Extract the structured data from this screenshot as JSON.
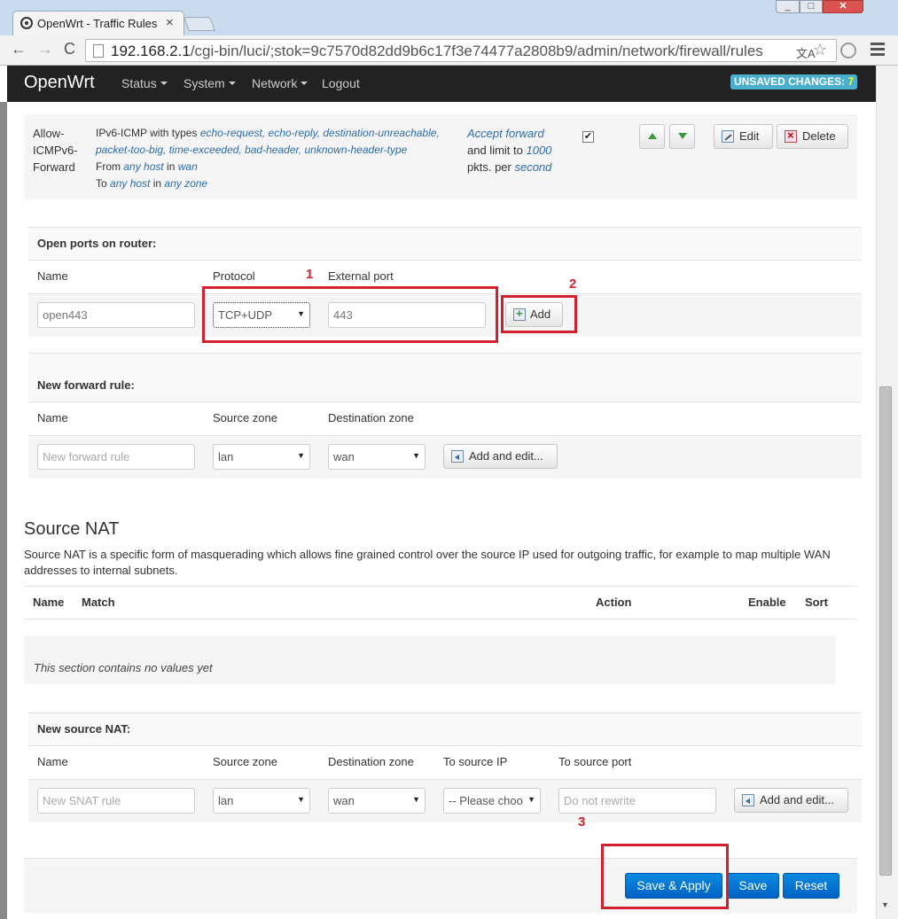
{
  "browser": {
    "tab_title": "OpenWrt - Traffic Rules",
    "tab_close": "×",
    "win_min": "_",
    "win_max": "□",
    "win_close": "✕",
    "back": "←",
    "forward": "→",
    "reload": "C",
    "url_host": "192.168.2.1",
    "url_path": "/cgi-bin/luci/;stok=9c7570d82dd9b6c17f3e74477a2808b9/admin/network/firewall/rules",
    "translate": "文A",
    "star": "☆"
  },
  "header": {
    "brand": "OpenWrt",
    "nav": [
      "Status",
      "System",
      "Network",
      "Logout"
    ],
    "unsaved_label": "UNSAVED CHANGES:",
    "unsaved_count": "7"
  },
  "rule": {
    "name": "Allow-ICMPv6-Forward",
    "match_prefix": "IPv6-ICMP with types ",
    "types": "echo-request, echo-reply, destination-unreachable, packet-too-big, time-exceeded, bad-header, unknown-header-type",
    "from_prefix": "From ",
    "from_host": "any host",
    "from_in": " in ",
    "from_zone": "wan",
    "to_prefix": "To ",
    "to_host": "any host",
    "to_in": " in ",
    "to_zone": "any zone",
    "action": "Accept forward",
    "limit_prefix": "and limit to ",
    "limit_value": "1000",
    "limit_suffix": "pkts. per ",
    "limit_unit": "second",
    "enabled_mark": "✔",
    "edit_label": "Edit",
    "delete_label": "Delete"
  },
  "open_ports": {
    "title": "Open ports on router:",
    "col_name": "Name",
    "col_protocol": "Protocol",
    "col_port": "External port",
    "name_value": "open443",
    "protocol_value": "TCP+UDP",
    "port_value": "443",
    "add_label": "Add"
  },
  "forward_rule": {
    "title": "New forward rule:",
    "col_name": "Name",
    "col_src": "Source zone",
    "col_dest": "Destination zone",
    "name_placeholder": "New forward rule",
    "src_value": "lan",
    "dest_value": "wan",
    "add_label": "Add and edit..."
  },
  "snat": {
    "heading": "Source NAT",
    "description": "Source NAT is a specific form of masquerading which allows fine grained control over the source IP used for outgoing traffic, for example to map multiple WAN addresses to internal subnets.",
    "th_name": "Name",
    "th_match": "Match",
    "th_action": "Action",
    "th_enable": "Enable",
    "th_sort": "Sort",
    "empty": "This section contains no values yet"
  },
  "new_snat": {
    "title": "New source NAT:",
    "col_name": "Name",
    "col_src": "Source zone",
    "col_dest": "Destination zone",
    "col_to_ip": "To source IP",
    "col_to_port": "To source port",
    "name_placeholder": "New SNAT rule",
    "src_value": "lan",
    "dest_value": "wan",
    "to_ip_value": "-- Please choo",
    "to_port_placeholder": "Do not rewrite",
    "add_label": "Add and edit..."
  },
  "footer": {
    "save_apply": "Save & Apply",
    "save": "Save",
    "reset": "Reset"
  },
  "annotations": [
    "1",
    "2",
    "3"
  ],
  "colors": {
    "annotation_red": "#d2202c",
    "primary_blue": "#0a7fd9",
    "link_blue": "#2a6cb0",
    "navbar": "#222222"
  }
}
